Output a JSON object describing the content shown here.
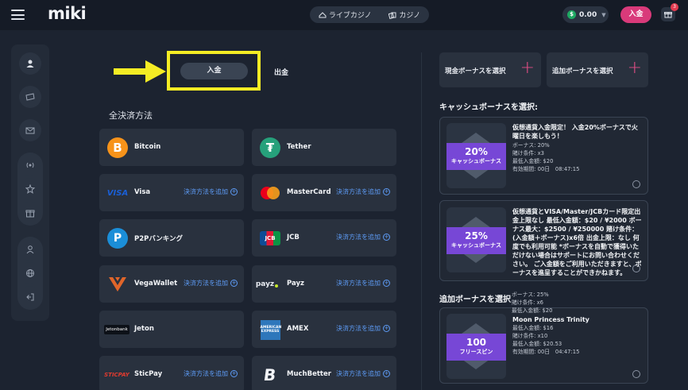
{
  "header": {
    "logo": "miki",
    "live_casino": "ライブカジノ",
    "casino": "カジノ",
    "balance": "0.00",
    "coin_symbol": "$",
    "deposit_button": "入金",
    "gift_count": "3"
  },
  "tabs": {
    "deposit": "入金",
    "withdraw": "出金"
  },
  "section_title": "全決済方法",
  "add_method_label": "決済方法を追加",
  "payment_methods": [
    {
      "name": "Bitcoin",
      "logo": "B",
      "color": "#f7931a"
    },
    {
      "name": "Tether",
      "logo": "₮",
      "color": "#26a17b"
    },
    {
      "name": "Visa",
      "logo": "VISA",
      "color": "#1a5fd6"
    },
    {
      "name": "MasterCard",
      "logo": "mastercard-icon",
      "color": "#eb001b"
    },
    {
      "name": "P2Pバンキング",
      "logo": "P",
      "color": "#1b8ed8"
    },
    {
      "name": "JCB",
      "logo": "JCB",
      "color": "#0e4c96"
    },
    {
      "name": "VegaWallet",
      "logo": "vega-icon",
      "color": "#e0652a"
    },
    {
      "name": "Payz",
      "logo": "payz",
      "color": "#222"
    },
    {
      "name": "Jeton",
      "logo": "Jetonbank",
      "color": "#ffffff"
    },
    {
      "name": "AMEX",
      "logo": "AMERICAN EXPRESS",
      "color": "#2e77bb"
    },
    {
      "name": "SticPay",
      "logo": "STICPAY",
      "color": "#e23b2f"
    },
    {
      "name": "MuchBetter",
      "logo": "B",
      "color": "#ffffff"
    }
  ],
  "bonus": {
    "cash_select": "現金ボーナスを選択",
    "extra_select": "追加ボーナスを選択",
    "cash_heading": "キャッシュボーナスを選択:",
    "extra_heading": "追加ボーナスを選択",
    "cards": [
      {
        "badge_big": "20%",
        "badge_small": "キャッシュボーナス",
        "title": "仮想通貨入金限定！ 入金20%ボーナスで火曜日を楽しもう！",
        "details": [
          "ボーナス: 20%",
          "賭け条件: x3",
          "最低入金額: $20",
          "有効期間: 00日　08:47:15"
        ]
      },
      {
        "badge_big": "25%",
        "badge_small": "キャッシュボーナス",
        "title": "仮想通貨とVISA/Master/JCBカード限定出金上限なし 最低入金額：$20 / ¥2000 ボーナス最大：$2500 / ¥250000 賭け条件：(入金額＋ボーナス)x6倍 出金上限：なし 何度でも利用可能 *ボーナスを自動で獲得いただけない場合はサポートにお問い合わせください。 ご入金額をご利用いただきますと、ボーナスを進呈することができかねます。",
        "details": [
          "ボーナス: 25%",
          "賭け条件: x6",
          "最低入金額: $20"
        ]
      },
      {
        "badge_big": "100",
        "badge_small": "フリースピン",
        "title": "Moon Princess Trinity",
        "details": [
          "最低入金額: $16",
          "賭け条件: x10",
          "最低入金額: $20.53",
          "有効期間: 00日　04:47:15"
        ]
      }
    ]
  },
  "colors": {
    "accent_pink": "#d93a7a",
    "highlight_yellow": "#f5ec24",
    "link_blue": "#5d9bf5",
    "badge_purple": "#7747d6"
  }
}
